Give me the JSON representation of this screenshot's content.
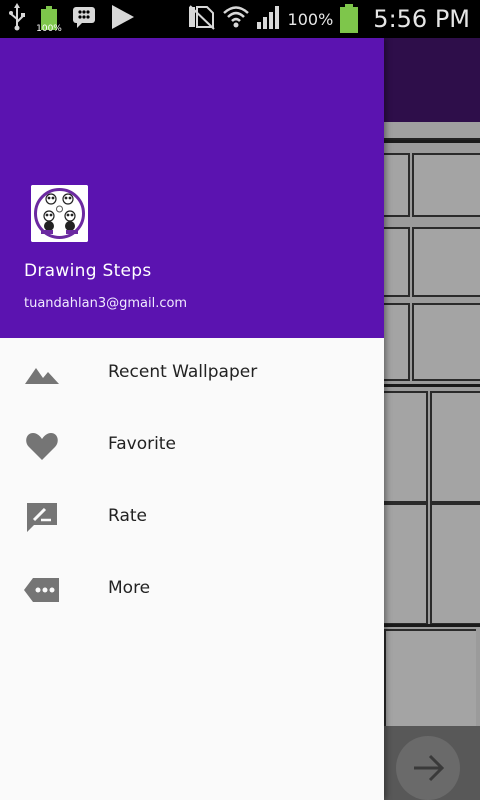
{
  "status_bar": {
    "battery_small_label": "100%",
    "battery_percent": "100%",
    "time": "5:56 PM",
    "icons": [
      "usb-icon",
      "battery-charging-icon",
      "bbm-icon",
      "play-store-icon",
      "no-sim-icon",
      "wifi-icon",
      "signal-icon",
      "battery-icon"
    ]
  },
  "drawer": {
    "app_name": "Drawing Steps",
    "email": "tuandahlan3@gmail.com",
    "header_color": "#5b13b0",
    "menu": [
      {
        "label": "Recent Wallpaper",
        "icon": "landscape-icon"
      },
      {
        "label": "Favorite",
        "icon": "heart-icon"
      },
      {
        "label": "Rate",
        "icon": "rate-review-icon"
      },
      {
        "label": "More",
        "icon": "more-label-icon"
      }
    ]
  },
  "background_app": {
    "toolbar_color": "#2e0e4a",
    "fab_icon": "arrow-forward-icon"
  }
}
